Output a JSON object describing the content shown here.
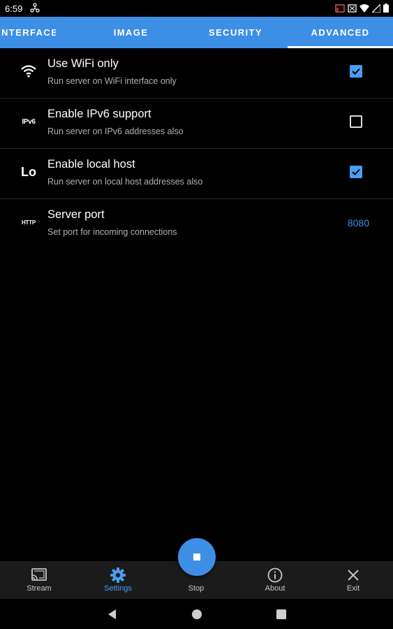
{
  "status_bar": {
    "time": "6:59"
  },
  "tabs": [
    {
      "label": "INTERFACE"
    },
    {
      "label": "IMAGE"
    },
    {
      "label": "SECURITY"
    },
    {
      "label": "ADVANCED"
    }
  ],
  "settings": [
    {
      "icon": "wifi-icon",
      "title": "Use WiFi only",
      "subtitle": "Run server on WiFi interface only",
      "checked": true
    },
    {
      "icon": "ipv6-icon",
      "icon_text": "IPv6",
      "title": "Enable IPv6 support",
      "subtitle": "Run server on IPv6 addresses also",
      "checked": false
    },
    {
      "icon": "localhost-icon",
      "icon_text": "Lo",
      "title": "Enable local host",
      "subtitle": "Run server on local host addresses also",
      "checked": true
    },
    {
      "icon": "http-icon",
      "icon_text": "HTTP",
      "title": "Server port",
      "subtitle": "Set port for incoming connections",
      "value": "8080"
    }
  ],
  "bottom_nav": [
    {
      "label": "Stream",
      "icon": "cast-icon"
    },
    {
      "label": "Settings",
      "icon": "gear-icon",
      "active": true
    },
    {
      "label": "Stop",
      "icon": "stop-icon"
    },
    {
      "label": "About",
      "icon": "info-icon"
    },
    {
      "label": "Exit",
      "icon": "close-icon"
    }
  ],
  "colors": {
    "accent": "#3d8fe6",
    "background": "#000000",
    "bottom_nav_bg": "#1b1b1b"
  }
}
